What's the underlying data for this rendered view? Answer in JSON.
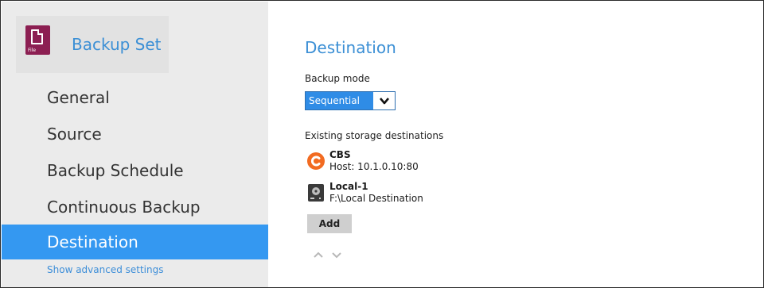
{
  "sidebar": {
    "header": {
      "title": "Backup Set",
      "icon": "file-backup-set-icon",
      "icon_tag": "File"
    },
    "items": [
      {
        "label": "General"
      },
      {
        "label": "Source"
      },
      {
        "label": "Backup Schedule"
      },
      {
        "label": "Continuous Backup"
      },
      {
        "label": "Destination",
        "active": true
      }
    ],
    "advanced_link": "Show advanced settings"
  },
  "main": {
    "title": "Destination",
    "backup_mode": {
      "label": "Backup mode",
      "selected": "Sequential"
    },
    "existing_label": "Existing storage destinations",
    "destinations": [
      {
        "name": "CBS",
        "detail": "Host: 10.1.0.10:80",
        "icon": "cbs-icon"
      },
      {
        "name": "Local-1",
        "detail": "F:\\Local Destination",
        "icon": "local-disk-icon"
      }
    ],
    "add_label": "Add"
  },
  "colors": {
    "accent": "#3498f1",
    "title_blue": "#3b8fd5",
    "app_icon": "#8c1f52",
    "cbs_orange": "#f26b21"
  }
}
